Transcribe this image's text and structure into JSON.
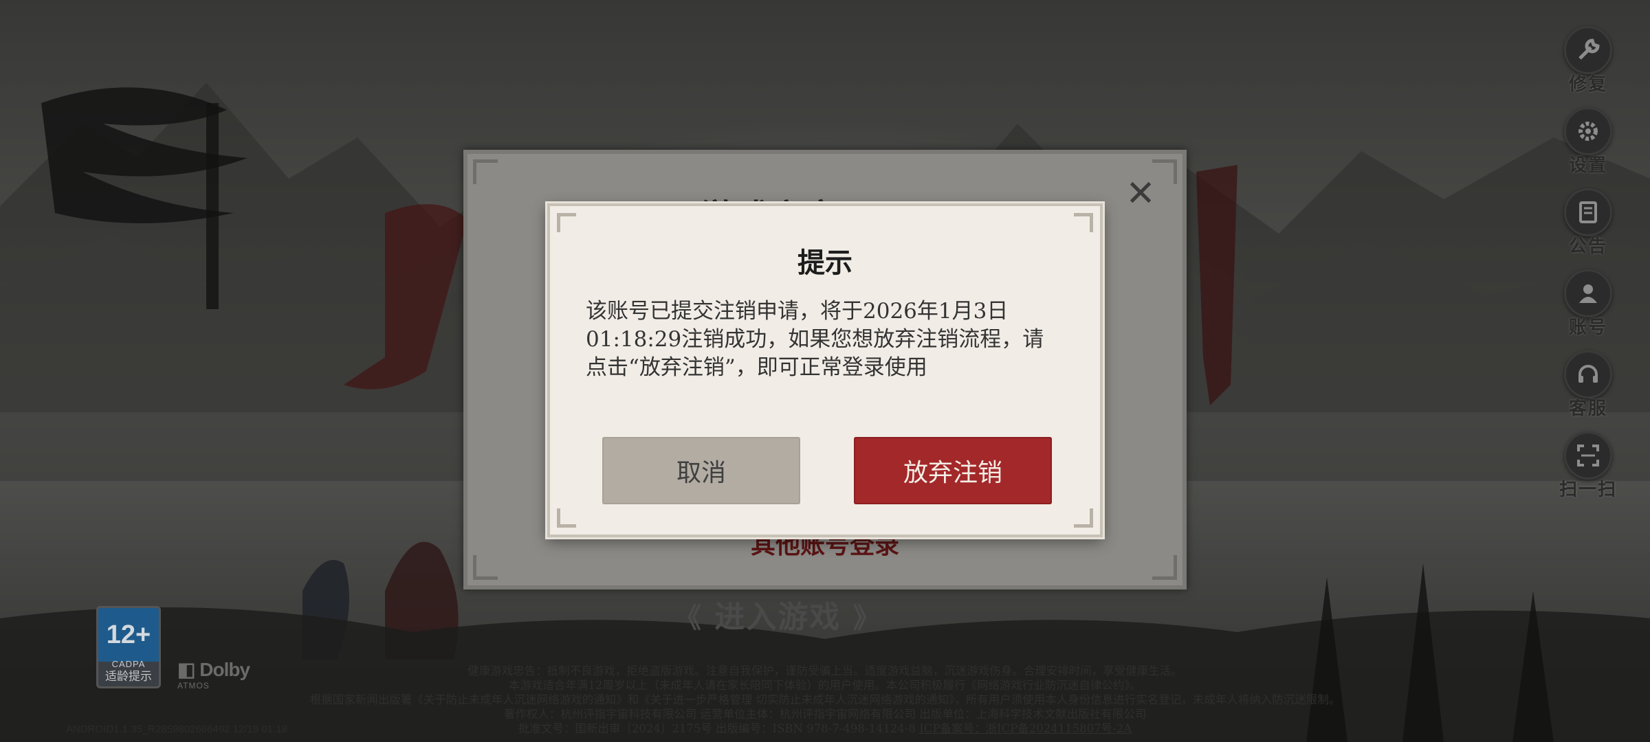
{
  "modal": {
    "title": "提示",
    "message": "该账号已提交注销申请，将于2026年1月3日01:18:29注销成功，如果您想放弃注销流程，请点击“放弃注销”，即可正常登录使用",
    "cancel_label": "取消",
    "confirm_label": "放弃注销"
  },
  "login_panel": {
    "close_icon": "close-icon",
    "brand_text": "游戏宇宙",
    "other_account_label": "其他账号登录"
  },
  "enter_game_label": "进入游戏",
  "side_menu": [
    {
      "icon": "wrench-icon",
      "label": "修复"
    },
    {
      "icon": "gear-icon",
      "label": "设置"
    },
    {
      "icon": "notice-icon",
      "label": "公告"
    },
    {
      "icon": "account-icon",
      "label": "账号"
    },
    {
      "icon": "headset-icon",
      "label": "客服"
    },
    {
      "icon": "scan-icon",
      "label": "扫一扫"
    }
  ],
  "age_rating": {
    "value": "12+",
    "org": "CADPA",
    "label": "适龄提示"
  },
  "dolby": {
    "main": "Dolby",
    "sub": "ATMOS"
  },
  "footer": {
    "line1": "健康游戏忠告：抵制不良游戏，拒绝盗版游戏。注意自我保护，谨防受骗上当。适度游戏益脑，沉迷游戏伤身。合理安排时间，享受健康生活。",
    "line2": "本游戏适合年满12周岁以上（未成年人请在家长陪同下体验）的用户使用。本公司积极履行《网络游戏行业防沉迷自律公约》。",
    "line3": "根据国家新闻出版署《关于防止未成年人沉迷网络游戏的通知》和《关于进一步严格管理 切实防止未成年人沉迷网络游戏的通知》，所有用户须使用本人身份信息进行实名登记，未成年人将纳入防沉迷限制。",
    "line4": "著作权人：杭州评指宇宙科技有限公司   运营单位主体：杭州评指宇宙网络有限公司   出版单位：上海科学技术文献出版社有限公司",
    "line5_a": "批准文号：国新出审〔2024〕2175号   出版编号：ISBN 978-7-498-14124-8   ",
    "line5_b": "ICP备案号：浙ICP备2024115807号-2A"
  },
  "version": "ANDROID1.1.35_R2859802666492 12/19 01:18"
}
